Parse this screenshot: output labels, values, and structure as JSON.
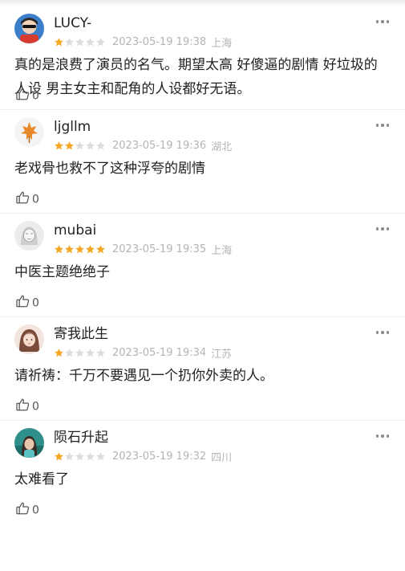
{
  "colors": {
    "star_filled": "#f5a623",
    "star_empty": "#dcdcdc",
    "meta_text": "#b4b4b4"
  },
  "comments": [
    {
      "username": "LUCY-",
      "rating": 1,
      "datetime": "2023-05-19 19:38",
      "location": "上海",
      "text": "真的是浪费了演员的名气。期望太高 好傻逼的剧情 好垃圾的人设 男主女主和配角的人设都好无语。",
      "likes": "0",
      "avatar": "avatar-girl-cartoon"
    },
    {
      "username": "ljgllm",
      "rating": 2,
      "datetime": "2023-05-19 19:36",
      "location": "湖北",
      "text": "老戏骨也救不了这种浮夸的剧情",
      "likes": "0",
      "avatar": "avatar-maple-leaf"
    },
    {
      "username": "mubai",
      "rating": 5,
      "datetime": "2023-05-19 19:35",
      "location": "上海",
      "text": "中医主题绝绝子",
      "likes": "0",
      "avatar": "avatar-sketch-girl"
    },
    {
      "username": "寄我此生",
      "rating": 1,
      "datetime": "2023-05-19 19:34",
      "location": "江苏",
      "text": "请祈祷：千万不要遇见一个扔你外卖的人。",
      "likes": "0",
      "avatar": "avatar-girl-portrait"
    },
    {
      "username": "陨石升起",
      "rating": 1,
      "datetime": "2023-05-19 19:32",
      "location": "四川",
      "text": "太难看了",
      "likes": "0",
      "avatar": "avatar-teal-portrait"
    }
  ]
}
